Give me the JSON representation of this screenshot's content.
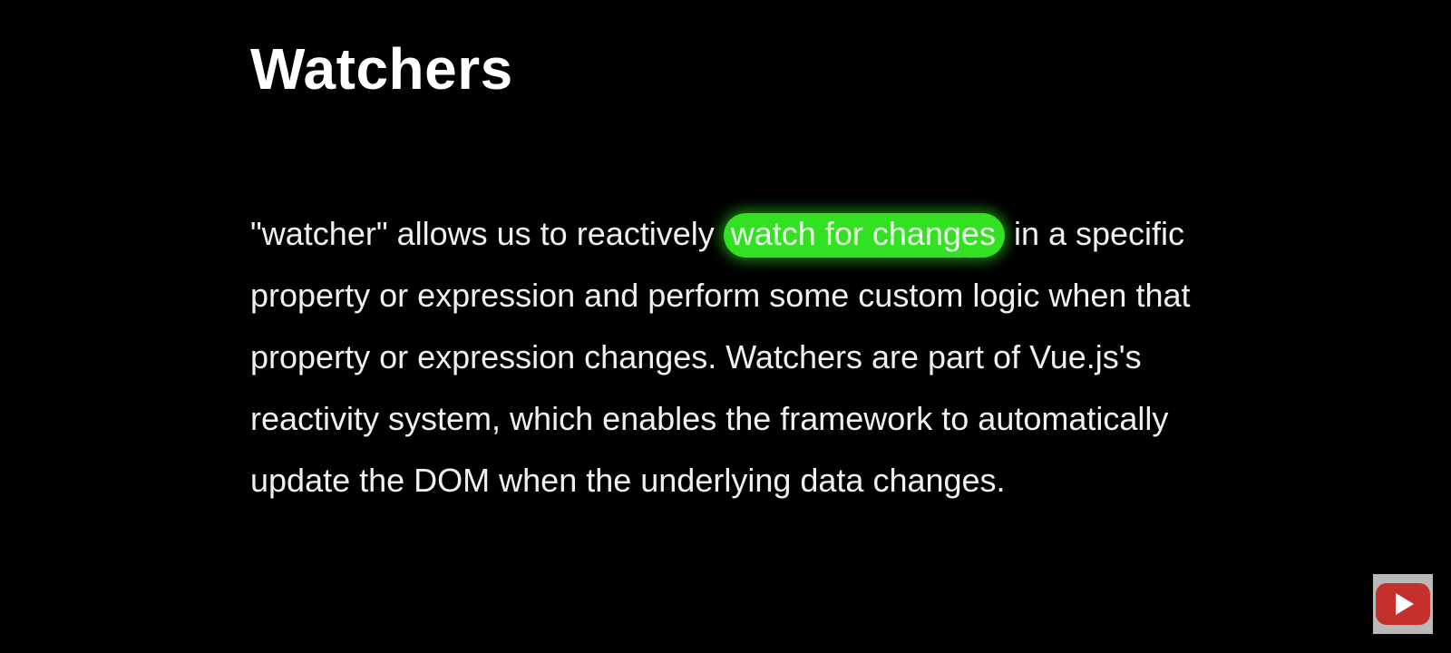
{
  "slide": {
    "title": "Watchers",
    "paragraph": {
      "before": "\"watcher\" allows us to reactively ",
      "highlight": "watch for changes",
      "after": " in a specific property or expression and perform some custom logic when that property or expression changes. Watchers are part of Vue.js's reactivity system, which enables the framework to automatically update the DOM when the underlying data changes."
    },
    "highlight_color": "#33e022"
  },
  "badge": {
    "icon": "youtube-play-icon",
    "color": "#c4302b"
  }
}
